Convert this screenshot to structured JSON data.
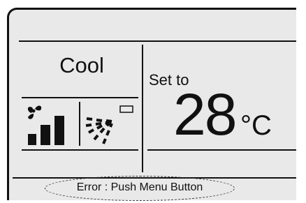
{
  "display": {
    "mode": "Cool",
    "set_label": "Set to",
    "temperature": "28",
    "unit": "°C"
  },
  "status": {
    "message": "Error : Push Menu Button"
  },
  "icons": {
    "fan_speed": "fan-speed-icon",
    "airflow": "airflow-swing-icon"
  },
  "colors": {
    "lcd_background": "#e9e9e9",
    "ink": "#111111"
  }
}
